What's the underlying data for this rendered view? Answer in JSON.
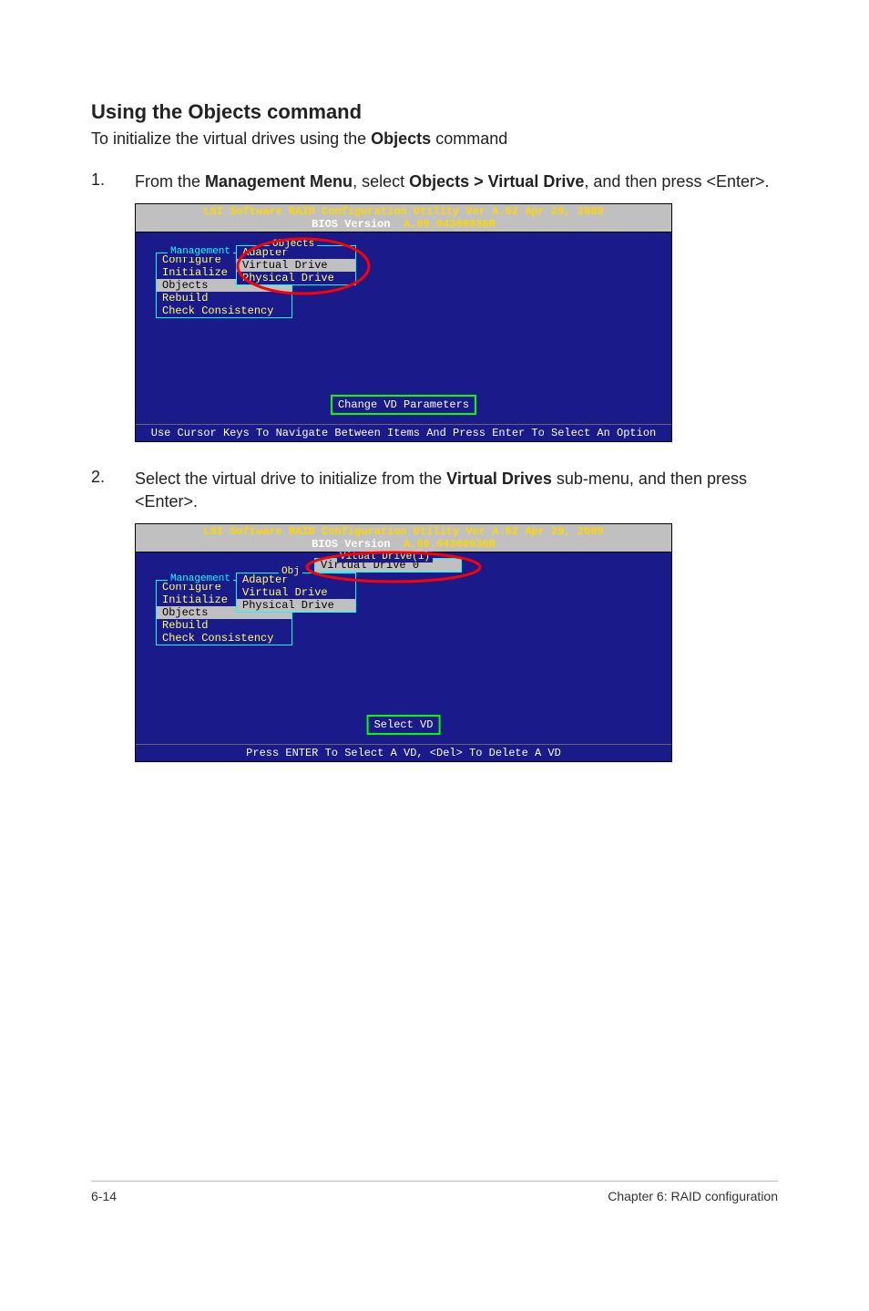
{
  "heading": "Using the Objects command",
  "intro_pre": "To initialize the virtual drives using the ",
  "intro_bold": "Objects",
  "intro_post": " command",
  "steps": [
    {
      "num": "1.",
      "segments": [
        {
          "t": "From the "
        },
        {
          "t": "Management Menu",
          "b": true
        },
        {
          "t": ", select "
        },
        {
          "t": "Objects > Virtual Drive",
          "b": true
        },
        {
          "t": ", and then press <Enter>."
        }
      ]
    },
    {
      "num": "2.",
      "segments": [
        {
          "t": "Select the virtual drive to initialize from the "
        },
        {
          "t": "Virtual Drives",
          "b": true
        },
        {
          "t": " sub-menu, and then press <Enter>."
        }
      ]
    }
  ],
  "bios": {
    "title_line1": "LSI Software RAID Configuration Utility Ver A.62 Apr 29, 2009",
    "title_line2": "BIOS Version  A.09.04300936R",
    "mgmt_title": "Management",
    "mgmt_items": [
      "Configure",
      "Initialize",
      "Objects",
      "Rebuild",
      "Check Consistency"
    ],
    "mgmt_selected_index_fig1": 2,
    "mgmt_selected_index_fig2": 2,
    "obj_title_fig1": "Objects",
    "obj_title_fig2": "Obj",
    "obj_items": [
      "Adapter",
      "Virtual Drive",
      "Physical Drive"
    ],
    "obj_selected_index_fig1": 1,
    "obj_selected_index_fig2": 2,
    "vd_title": "Vitual Drive(1)",
    "vd_items": [
      "Virtual Drive 0"
    ],
    "vd_selected_index": 0,
    "status_fig1": "Change VD Parameters",
    "status_fig2": "Select VD",
    "footer_fig1": "Use Cursor Keys To Navigate Between Items And Press Enter To Select An Option",
    "footer_fig2": "Press ENTER To Select A VD, <Del> To Delete A VD"
  },
  "footer_left": "6-14",
  "footer_right": "Chapter 6: RAID configuration"
}
